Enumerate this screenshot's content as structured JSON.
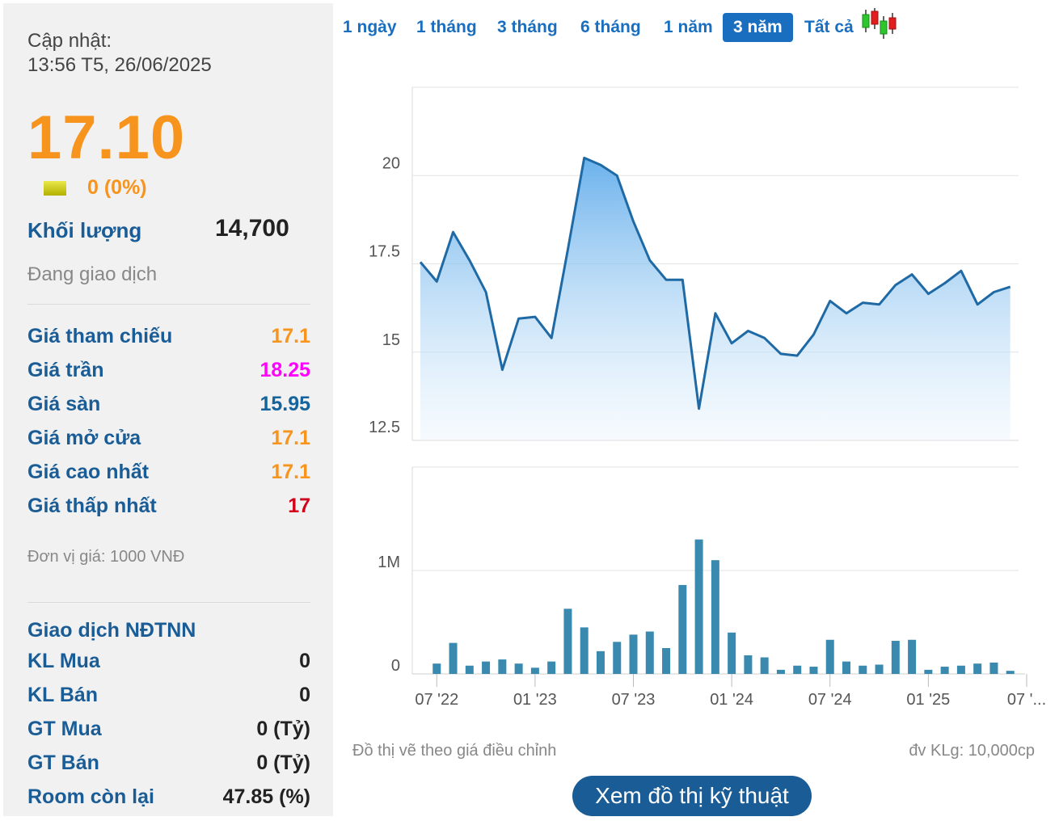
{
  "summary": {
    "update_label": "Cập nhật:",
    "update_time": "13:56 T5, 26/06/2025",
    "price": "17.10",
    "change": "0 (0%)",
    "volume_label": "Khối lượng",
    "volume_value": "14,700",
    "status": "Đang giao dịch",
    "colors": {
      "price": "#f7941d",
      "reference": "#f7941d",
      "ceiling": "#ff00ff",
      "floor": "#1a6ec0",
      "low": "#e00000",
      "label": "#1a5c96"
    }
  },
  "prices": [
    {
      "label": "Giá tham chiếu",
      "value": "17.1",
      "color": "#f7941d"
    },
    {
      "label": "Giá trần",
      "value": "18.25",
      "color": "#ff00ff"
    },
    {
      "label": "Giá sàn",
      "value": "15.95",
      "color": "#14639c"
    },
    {
      "label": "Giá mở cửa",
      "value": "17.1",
      "color": "#f7941d"
    },
    {
      "label": "Giá cao nhất",
      "value": "17.1",
      "color": "#f7941d"
    },
    {
      "label": "Giá thấp nhất",
      "value": "17",
      "color": "#d0021b"
    }
  ],
  "unit_note": "Đơn vị giá: 1000 VNĐ",
  "foreign": {
    "title": "Giao dịch NĐTNN",
    "rows": [
      {
        "label": "KL Mua",
        "value": "0"
      },
      {
        "label": "KL Bán",
        "value": "0"
      },
      {
        "label": "GT Mua",
        "value": "0 (Tỷ)"
      },
      {
        "label": "GT Bán",
        "value": "0 (Tỷ)"
      },
      {
        "label": "Room còn lại",
        "value": "47.85 (%)"
      }
    ]
  },
  "tabs": {
    "items": [
      "1 ngày",
      "1 tháng",
      "3 tháng",
      "6 tháng",
      "1 năm",
      "3 năm",
      "Tất cả"
    ],
    "active": "3 năm",
    "candle_icon": "candlestick-icon"
  },
  "chart_data": {
    "type": "area",
    "price": {
      "y_ticks": [
        "20",
        "17.5",
        "15",
        "12.5"
      ],
      "ylim": [
        12.5,
        22.5
      ],
      "x": [
        "2022-06",
        "2022-07",
        "2022-08",
        "2022-09",
        "2022-10",
        "2022-11",
        "2022-12",
        "2023-01",
        "2023-02",
        "2023-03",
        "2023-04",
        "2023-05",
        "2023-06",
        "2023-07",
        "2023-08",
        "2023-09",
        "2023-10",
        "2023-11",
        "2023-12",
        "2024-01",
        "2024-02",
        "2024-03",
        "2024-04",
        "2024-05",
        "2024-06",
        "2024-07",
        "2024-08",
        "2024-09",
        "2024-10",
        "2024-11",
        "2024-12",
        "2025-01",
        "2025-02",
        "2025-03",
        "2025-04",
        "2025-05",
        "2025-06"
      ],
      "values": [
        17.55,
        17.0,
        18.4,
        17.6,
        16.7,
        14.5,
        15.95,
        16.0,
        15.4,
        17.9,
        20.5,
        20.3,
        20.0,
        18.7,
        17.6,
        17.05,
        17.05,
        13.4,
        16.1,
        15.25,
        15.6,
        15.4,
        14.95,
        14.9,
        15.5,
        16.45,
        16.1,
        16.4,
        16.35,
        16.9,
        17.2,
        16.65,
        16.95,
        17.3,
        16.35,
        16.7,
        16.85
      ]
    },
    "volume": {
      "y_ticks": [
        "1M",
        "0"
      ],
      "ylim": [
        0,
        2000000
      ],
      "values": [
        0,
        100000,
        300000,
        80000,
        120000,
        140000,
        100000,
        60000,
        120000,
        630000,
        450000,
        220000,
        310000,
        380000,
        410000,
        250000,
        860000,
        1300000,
        1100000,
        400000,
        180000,
        160000,
        40000,
        80000,
        70000,
        330000,
        120000,
        80000,
        90000,
        320000,
        330000,
        40000,
        70000,
        80000,
        100000,
        110000,
        30000
      ]
    },
    "x_tick_labels": [
      "07 '22",
      "01 '23",
      "07 '23",
      "01 '24",
      "07 '24",
      "01 '25",
      "07 '..."
    ],
    "x_tick_index": [
      1,
      7,
      13,
      19,
      25,
      31,
      37
    ],
    "line_color": "#1f6aa5",
    "bar_color": "#3a8ab0",
    "grid": true
  },
  "footer": {
    "note_left": "Đồ thị vẽ theo giá điều chỉnh",
    "note_right": "đv KLg: 10,000cp",
    "tech_button": "Xem đồ thị kỹ thuật"
  }
}
